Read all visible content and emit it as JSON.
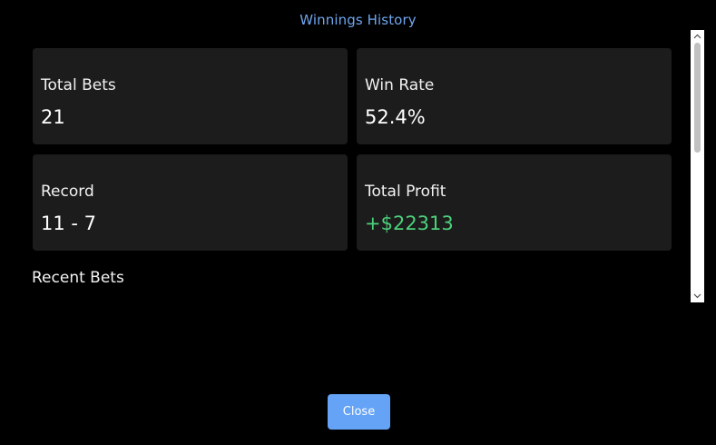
{
  "modal": {
    "title": "Winnings History"
  },
  "stats": {
    "total_bets": {
      "label": "Total Bets",
      "value": "21"
    },
    "win_rate": {
      "label": "Win Rate",
      "value": "52.4%"
    },
    "record": {
      "label": "Record",
      "value": "11 - 7"
    },
    "total_profit": {
      "label": "Total Profit",
      "value": "+$22313",
      "color": "#4cd17b"
    }
  },
  "recent_bets": {
    "heading": "Recent Bets"
  },
  "footer": {
    "close_label": "Close"
  },
  "colors": {
    "title": "#6fa6f0",
    "card_bg": "#1c1c1c",
    "button_bg": "#64a3f5",
    "background": "#000000"
  },
  "icons": {
    "scroll_up": "chevron-up-icon",
    "scroll_down": "chevron-down-icon"
  }
}
